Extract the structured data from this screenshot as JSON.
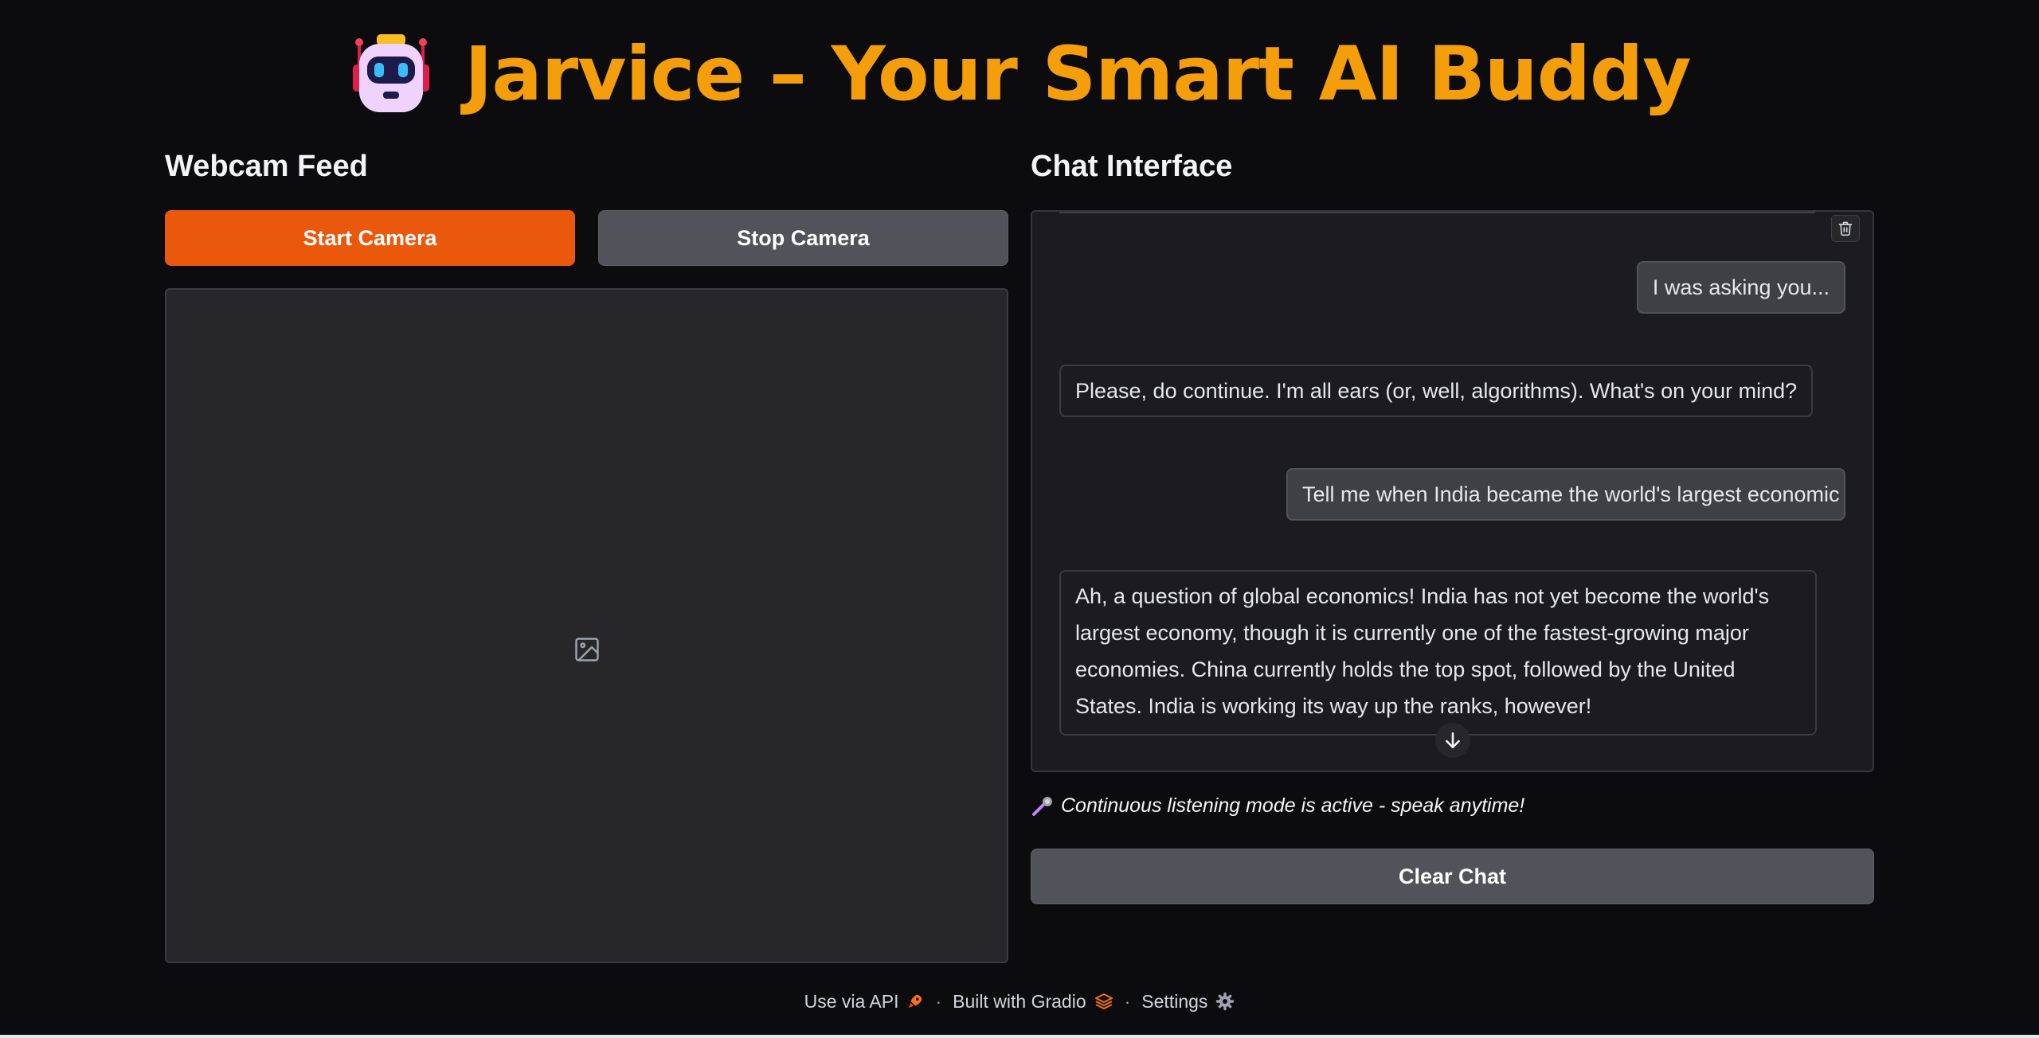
{
  "header": {
    "title": "Jarvice – Your Smart AI Buddy",
    "icon": "robot-icon",
    "title_color": "#f59e0b"
  },
  "webcam": {
    "heading": "Webcam Feed",
    "start_label": "Start Camera",
    "stop_label": "Stop Camera",
    "placeholder_icon": "image-icon"
  },
  "chat": {
    "heading": "Chat Interface",
    "messages": [
      {
        "role": "user",
        "text": "I was asking you..."
      },
      {
        "role": "assistant",
        "text": "Please, do continue. I'm all ears (or, well, algorithms). What's on your mind?"
      },
      {
        "role": "user",
        "text": "Tell me when India became the world's largest economic"
      },
      {
        "role": "assistant",
        "text": "Ah, a question of global economics! India has not yet become the world's largest economy, though it is currently one of the fastest-growing major economies. China currently holds the top spot, followed by the United States. India is working its way up the ranks, however!"
      }
    ],
    "status": "Continuous listening mode is active - speak anytime!",
    "status_icon": "microphone-icon",
    "clear_label": "Clear Chat"
  },
  "footer": {
    "api_label": "Use via API",
    "built_label": "Built with Gradio",
    "settings_label": "Settings",
    "separator": "·"
  },
  "colors": {
    "accent": "#ea580c",
    "background": "#0c0c0f",
    "secondary_button": "#52525b"
  }
}
